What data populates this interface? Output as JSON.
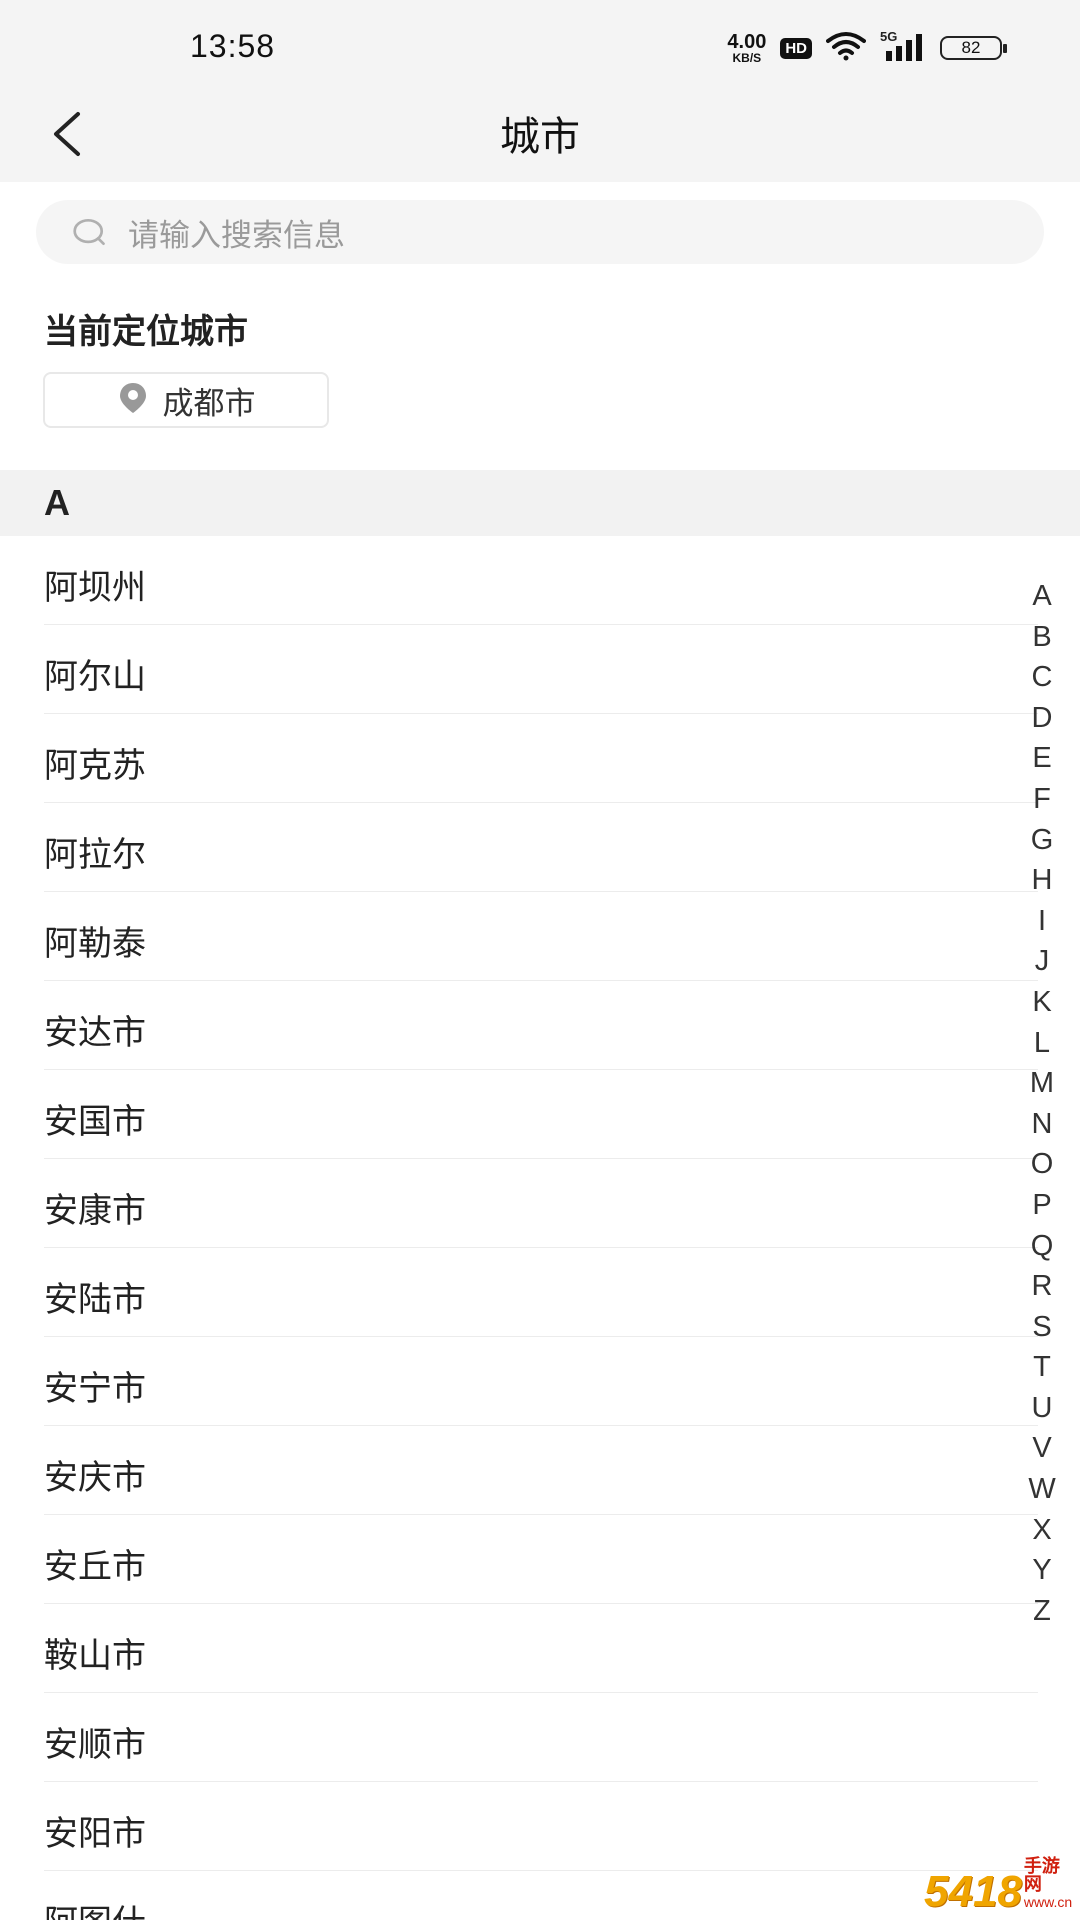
{
  "status_bar": {
    "time": "13:58",
    "net_speed_value": "4.00",
    "net_speed_unit": "KB/S",
    "hd_badge": "HD",
    "network_type": "5G",
    "battery_level": "82"
  },
  "header": {
    "title": "城市",
    "back_icon": "chevron-left-icon"
  },
  "search": {
    "placeholder": "请输入搜索信息",
    "icon": "search-icon"
  },
  "current_location": {
    "title": "当前定位城市",
    "city": "成都市",
    "icon": "location-pin-icon"
  },
  "section": {
    "letter": "A"
  },
  "cities": [
    "阿坝州",
    "阿尔山",
    "阿克苏",
    "阿拉尔",
    "阿勒泰",
    "安达市",
    "安国市",
    "安康市",
    "安陆市",
    "安宁市",
    "安庆市",
    "安丘市",
    "鞍山市",
    "安顺市",
    "安阳市",
    "阿图什"
  ],
  "index_letters": [
    "A",
    "B",
    "C",
    "D",
    "E",
    "F",
    "G",
    "H",
    "I",
    "J",
    "K",
    "L",
    "M",
    "N",
    "O",
    "P",
    "Q",
    "R",
    "S",
    "T",
    "U",
    "V",
    "W",
    "X",
    "Y",
    "Z"
  ],
  "watermark": {
    "logo": "5418",
    "text_cn": "手游网",
    "text_domain": "www.cn"
  },
  "colors": {
    "header_bg": "#f4f4f4",
    "section_bg": "#f2f2f2",
    "search_bg": "#f5f5f5",
    "text_primary": "#222222",
    "placeholder": "#9a9a9a",
    "divider": "#ececec"
  }
}
